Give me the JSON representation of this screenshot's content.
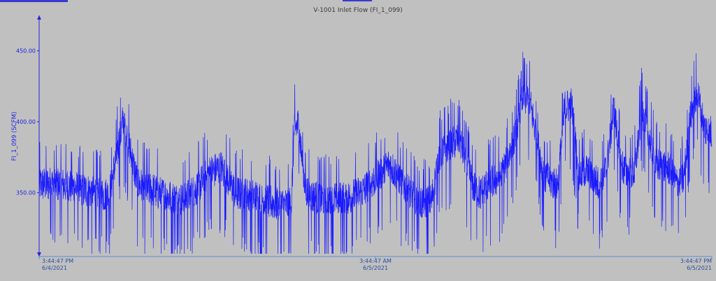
{
  "chart_data": {
    "type": "line",
    "title": "V-1001 Inlet Flow (FI_1_099)",
    "ylabel": "FI_1_099 (SCFM)",
    "xlabel": "",
    "ylim": [
      305,
      475
    ],
    "yticks": [
      "350.00",
      "400.00",
      "450.00"
    ],
    "ytick_values": [
      350,
      400,
      450
    ],
    "x_range_hours": [
      0,
      48
    ],
    "xticks": [
      {
        "time": "3:44:47 PM",
        "date": "6/4/2021"
      },
      {
        "time": "3:44:47 AM",
        "date": "6/5/2021"
      },
      {
        "time": "3:44:47 PM",
        "date": "6/5/2021"
      }
    ],
    "line_color": "#1a1aff",
    "background": "#c0c0c0",
    "grid": false,
    "series": [
      {
        "name": "",
        "x_hours": [
          0,
          1,
          2,
          3,
          4,
          5,
          6,
          7,
          7.5,
          8,
          9,
          10,
          11,
          11.5,
          12,
          13,
          14,
          15,
          16,
          17,
          17.5,
          18,
          18.2,
          18.5,
          19,
          19.5,
          20,
          21,
          22,
          23,
          24,
          25,
          26,
          27,
          28,
          28.5,
          29,
          30,
          31,
          31.5,
          32,
          33,
          34,
          34.5,
          35,
          36,
          37,
          37.5,
          38,
          38.5,
          39,
          40,
          40.5,
          41,
          41.5,
          42,
          42.5,
          43,
          44,
          45,
          45.5,
          46,
          46.5,
          47,
          47.5,
          48
        ],
        "values": [
          356,
          356,
          355,
          352,
          350,
          348,
          402,
          357,
          353,
          352,
          348,
          344,
          350,
          356,
          363,
          368,
          350,
          348,
          345,
          342,
          341,
          342,
          395,
          398,
          352,
          347,
          346,
          345,
          346,
          350,
          360,
          370,
          356,
          342,
          344,
          375,
          382,
          388,
          354,
          349,
          356,
          362,
          390,
          418,
          415,
          362,
          355,
          410,
          412,
          362,
          366,
          355,
          368,
          410,
          370,
          363,
          365,
          408,
          370,
          367,
          356,
          360,
          405,
          420,
          395,
          392
        ]
      }
    ]
  }
}
